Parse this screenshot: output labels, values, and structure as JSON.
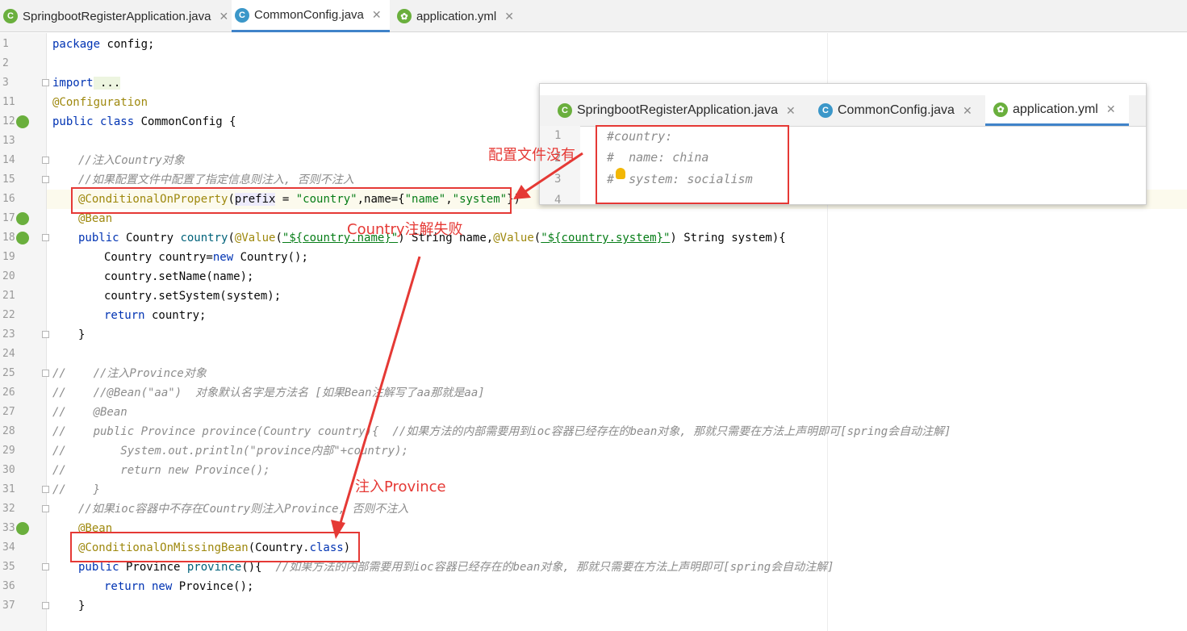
{
  "tabs": [
    {
      "label": "SpringbootRegisterApplication.java",
      "icon": "spring-boot-icon"
    },
    {
      "label": "CommonConfig.java",
      "icon": "class-icon"
    },
    {
      "label": "application.yml",
      "icon": "spring-yml-icon"
    }
  ],
  "editor": {
    "line_numbers": [
      "1",
      "2",
      "3",
      "11",
      "12",
      "13",
      "14",
      "15",
      "16",
      "17",
      "18",
      "19",
      "20",
      "21",
      "22",
      "23",
      "24",
      "25",
      "26",
      "27",
      "28",
      "29",
      "30",
      "31",
      "32",
      "33",
      "34",
      "35",
      "36",
      "37"
    ],
    "lines": {
      "l1": {
        "kw": "package",
        "rest": " config;"
      },
      "l3": {
        "kw": "import",
        "rest": " ..."
      },
      "l11": "@Configuration",
      "l12": {
        "kw": "public class",
        "rest": " CommonConfig {"
      },
      "l14": "//注入Country对象",
      "l15": "//如果配置文件中配置了指定信息则注入, 否则不注入",
      "l16": {
        "ann": "@ConditionalOnProperty",
        "p1": "(",
        "param": "prefix",
        "p2": " = ",
        "s1": "\"country\"",
        "p3": ",name={",
        "s2": "\"name\"",
        "p4": ",",
        "s3": "\"system\"",
        "p5": "})"
      },
      "l17": "@Bean",
      "l18": {
        "kw": "public",
        "a": " Country ",
        "m": "country",
        "b": "(",
        "ann1": "@Value",
        "c": "(",
        "s1": "\"${country.name}\"",
        "d": ") String name,",
        "ann2": "@Value",
        "e": "(",
        "s2": "\"${country.system}\"",
        "f": ") String system){"
      },
      "l19": {
        "a": "Country country=",
        "kw": "new",
        "b": " Country();"
      },
      "l20": "country.setName(name);",
      "l21": "country.setSystem(system);",
      "l22": {
        "kw": "return",
        "b": " country;"
      },
      "l23": "}",
      "l25": "//    //注入Province对象",
      "l26": "//    //@Bean(\"aa\")  对象默认名字是方法名 [如果Bean注解写了aa那就是aa]",
      "l27": "//    @Bean",
      "l28": "//    public Province province(Country country){  //如果方法的内部需要用到ioc容器已经存在的bean对象, 那就只需要在方法上声明即可[spring会自动注解]",
      "l29": "//        System.out.println(\"province内部\"+country);",
      "l30": "//        return new Province();",
      "l31": "//    }",
      "l32": "//如果ioc容器中不存在Country则注入Province, 否则不注入",
      "l33": "@Bean",
      "l34": {
        "ann": "@ConditionalOnMissingBean",
        "a": "(Country.",
        "kw": "class",
        "b": ")"
      },
      "l35": {
        "kw": "public",
        "a": " Province ",
        "m": "province",
        "b": "(){  ",
        "cmt": "//如果方法的内部需要用到ioc容器已经存在的bean对象, 那就只需要在方法上声明即可[spring会自动注解]"
      },
      "l36": {
        "kw": "return new",
        "b": " Province();"
      },
      "l37": "}"
    }
  },
  "overlay": {
    "tabs": [
      "SpringbootRegisterApplication.java",
      "CommonConfig.java",
      "application.yml"
    ],
    "line_numbers": [
      "1",
      "2",
      "3",
      "4"
    ],
    "lines": [
      "#country:",
      "#  name: china",
      "#  system: socialism",
      ""
    ]
  },
  "annotations": {
    "config_missing": "配置文件没有",
    "country_fail": "Country注解失败",
    "inject_province": "注入Province"
  },
  "colors": {
    "annotation_red": "#e53935",
    "keyword": "#0033b3",
    "string": "#067d17",
    "annotation": "#9e880d",
    "comment": "#8c8c8c"
  }
}
